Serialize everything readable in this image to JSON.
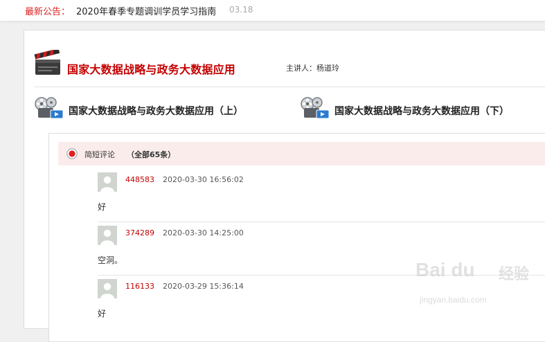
{
  "notice": {
    "label": "最新公告：",
    "text": "2020年春季专题调训学员学习指南",
    "date": "03.18"
  },
  "course": {
    "title": "国家大数据战略与政务大数据应用",
    "speaker_label": "主讲人：",
    "speaker_name": "杨道玲",
    "icon": "clapperboard-icon"
  },
  "videos": [
    {
      "label": "国家大数据战略与政务大数据应用（上）",
      "icon": "film-reel-icon"
    },
    {
      "label": "国家大数据战略与政务大数据应用（下）",
      "icon": "film-reel-icon"
    }
  ],
  "comments": {
    "title": "简短评论",
    "count": "（全部65条）",
    "items": [
      {
        "user": "448583",
        "time": "2020-03-30 16:56:02",
        "text": "好"
      },
      {
        "user": "374289",
        "time": "2020-03-30 14:25:00",
        "text": "空洞。"
      },
      {
        "user": "116133",
        "time": "2020-03-29 15:36:14",
        "text": "好"
      }
    ]
  },
  "watermark": {
    "logo": "Bai du",
    "cn": "经验",
    "url": "jingyan.baidu.com"
  },
  "colors": {
    "accent": "#c40000",
    "comment_bg": "#fbecec"
  }
}
